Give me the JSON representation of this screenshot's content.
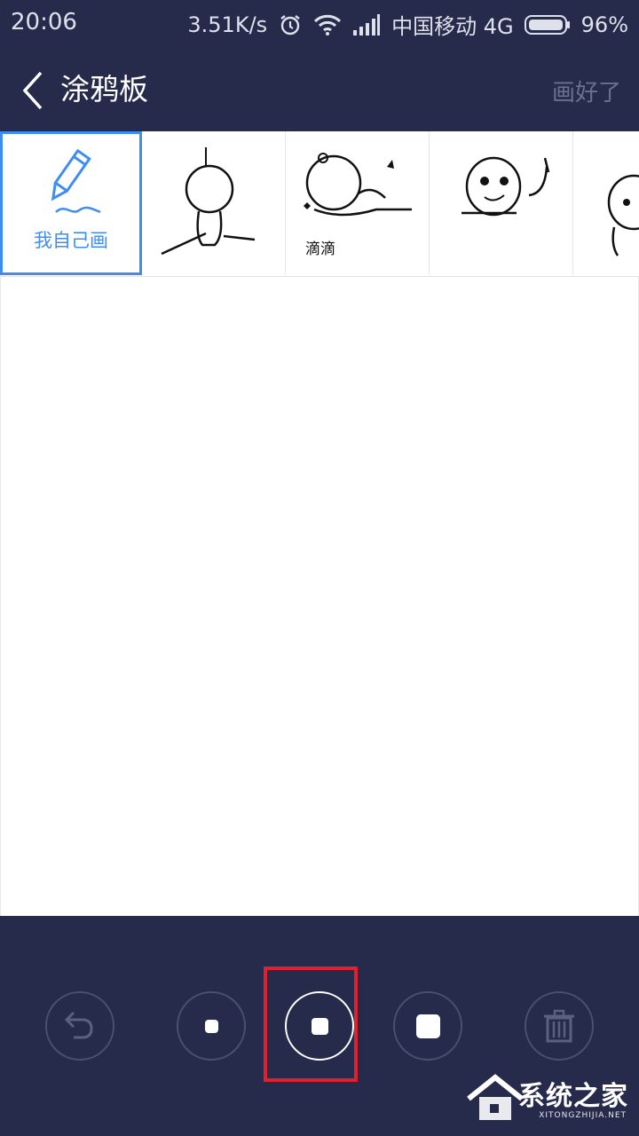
{
  "status_bar": {
    "time": "20:06",
    "net_speed": "3.51K/s",
    "carrier": "中国移动 4G",
    "battery": "96%",
    "icons": [
      "alarm-icon",
      "wifi-icon",
      "signal-icon",
      "battery-icon"
    ]
  },
  "app_bar": {
    "title": "涂鸦板",
    "done_label": "画好了"
  },
  "stickers": {
    "self_draw_label": "我自己画",
    "sticker_caption": "滴滴"
  },
  "toolbar": {
    "tools": [
      "undo-icon",
      "brush-size-small",
      "brush-size-medium",
      "brush-size-large",
      "trash-icon"
    ],
    "selected": "brush-size-medium"
  },
  "watermark": {
    "text": "系统之家",
    "sub": "XITONGZHIJIA.NET"
  },
  "colors": {
    "bar_bg": "#262a4b",
    "accent": "#3d8ef0",
    "highlight": "#e0202a"
  }
}
